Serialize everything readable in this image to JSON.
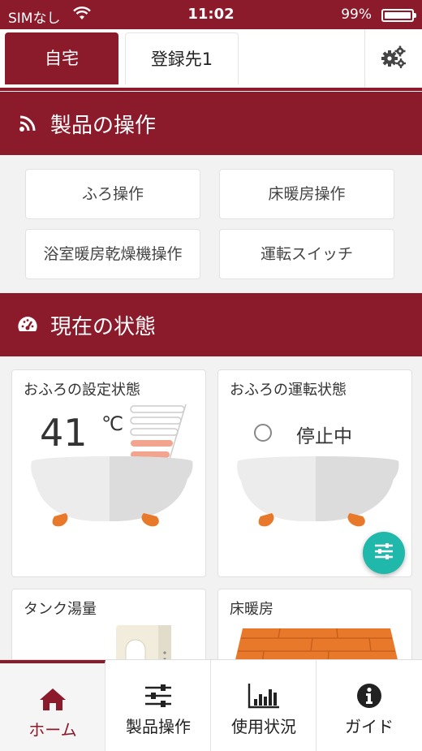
{
  "status_bar": {
    "carrier": "SIMなし",
    "time": "11:02",
    "battery": "99%"
  },
  "tabs": [
    {
      "label": "自宅",
      "active": true
    },
    {
      "label": "登録先1",
      "active": false
    }
  ],
  "products_section": {
    "title": "製品の操作",
    "buttons": [
      "ふろ操作",
      "床暖房操作",
      "浴室暖房乾燥機操作",
      "運転スイッチ"
    ]
  },
  "status_section": {
    "title": "現在の状態",
    "bath_setting": {
      "title": "おふろの設定状態",
      "temperature": "41",
      "unit": "℃"
    },
    "bath_running": {
      "title": "おふろの運転状態",
      "status": "停止中"
    },
    "tank": {
      "title": "タンク湯量"
    },
    "floor_heating": {
      "title": "床暖房"
    }
  },
  "bottom_nav": [
    {
      "label": "ホーム",
      "icon": "home-icon",
      "active": true
    },
    {
      "label": "製品操作",
      "icon": "sliders-icon",
      "active": false
    },
    {
      "label": "使用状況",
      "icon": "bar-chart-icon",
      "active": false
    },
    {
      "label": "ガイド",
      "icon": "info-icon",
      "active": false
    }
  ],
  "colors": {
    "brand": "#8b1a2b",
    "fab": "#20b8aa",
    "accent_orange": "#e8792a"
  }
}
